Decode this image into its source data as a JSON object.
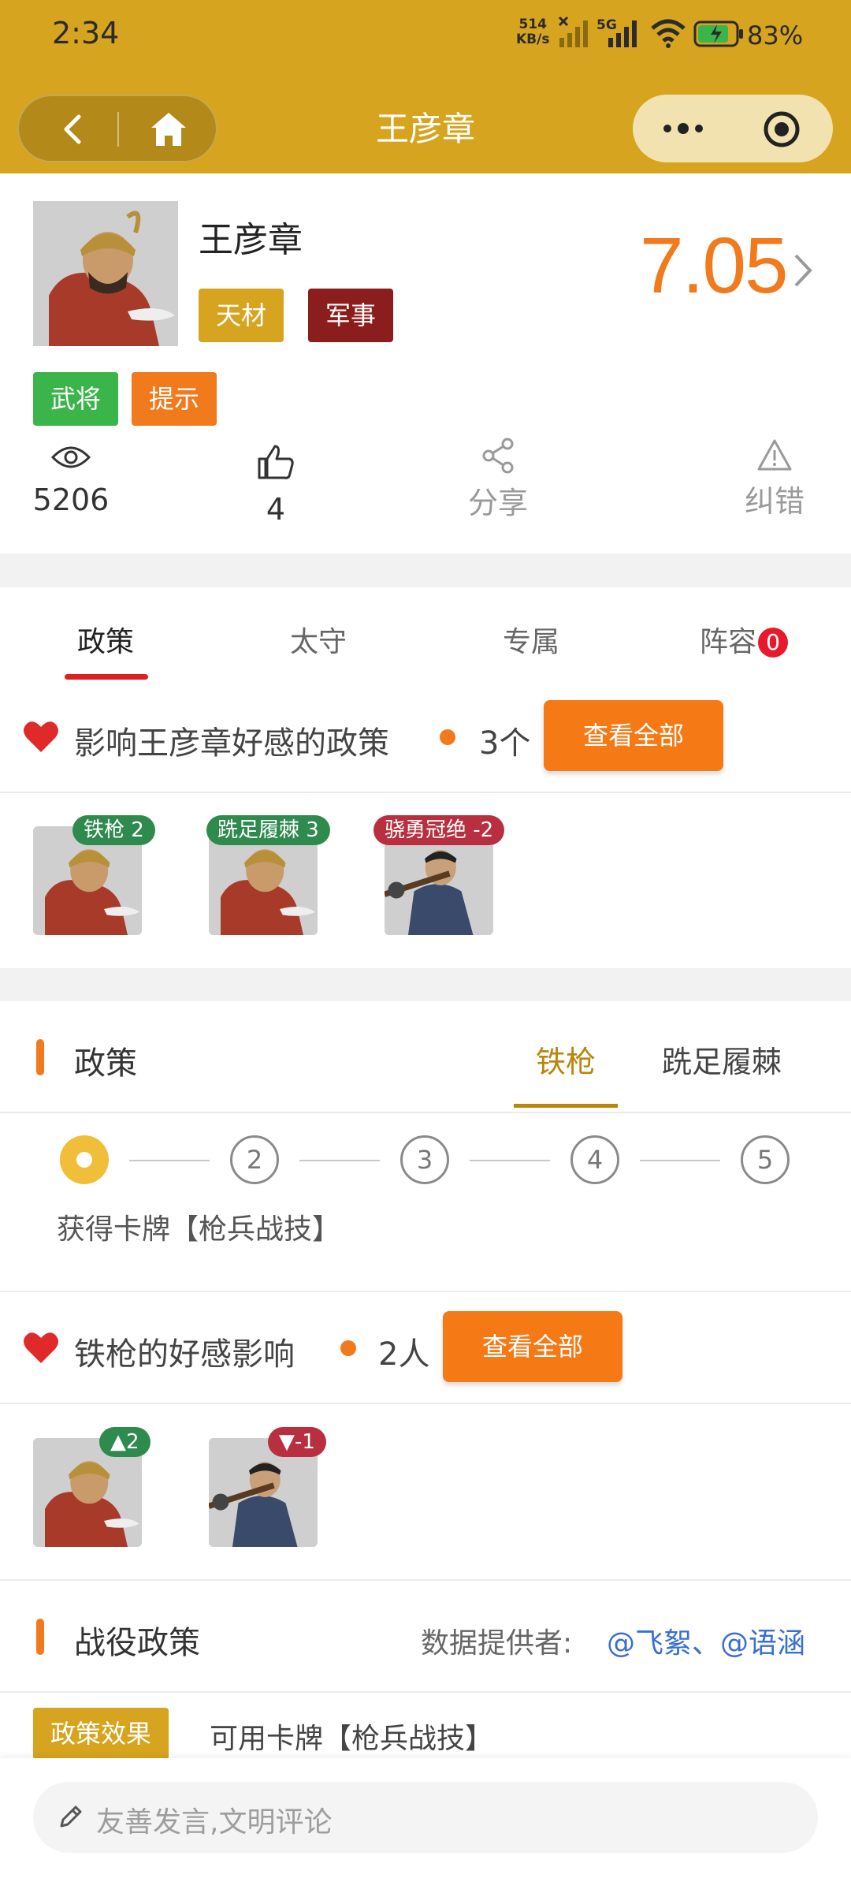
{
  "status_bar": {
    "time": "2:34",
    "net_speed_value": "514",
    "net_speed_unit": "KB/s",
    "network": "5G",
    "battery": "83%"
  },
  "nav": {
    "title": "王彦章"
  },
  "profile": {
    "name": "王彦章",
    "tags": [
      "天材",
      "军事"
    ],
    "type_tags": [
      "武将",
      "提示"
    ],
    "score": "7.05",
    "views": "5206",
    "likes": "4",
    "share_label": "分享",
    "report_label": "纠错"
  },
  "tabs": {
    "items": [
      "政策",
      "太守",
      "专属",
      "阵容"
    ],
    "active": "政策",
    "lineup_badge": "0"
  },
  "policy_favor": {
    "title": "影响王彦章好感的政策",
    "count": "3个",
    "view_all": "查看全部",
    "items": [
      {
        "label": "铁枪 2",
        "color": "#2f8a4d"
      },
      {
        "label": "跣足履棘 3",
        "color": "#2f8a4d"
      },
      {
        "label": "骁勇冠绝 -2",
        "color": "#b83040"
      }
    ]
  },
  "policy_section": {
    "title": "政策",
    "subtabs": [
      "铁枪",
      "跣足履棘"
    ],
    "active_subtab": "铁枪",
    "steps": [
      "",
      "2",
      "3",
      "4",
      "5"
    ],
    "description": "获得卡牌【枪兵战技】"
  },
  "iron_spear_favor": {
    "title": "铁枪的好感影响",
    "count": "2人",
    "view_all": "查看全部",
    "items": [
      {
        "label": "▲2",
        "color": "#2f8a4d"
      },
      {
        "label": "▼-1",
        "color": "#b83040"
      }
    ]
  },
  "campaign_policy": {
    "title": "战役政策",
    "provider_label": "数据提供者:",
    "providers": "@飞絮、@语涵",
    "effect_tag": "政策效果",
    "effect_text": "可用卡牌【枪兵战技】"
  },
  "comment": {
    "placeholder": "友善发言,文明评论"
  },
  "colors": {
    "brand": "#d6a41e",
    "accent": "#f07a1c",
    "red": "#e8192c",
    "green": "#3bb54a",
    "link": "#3a6fd0"
  }
}
